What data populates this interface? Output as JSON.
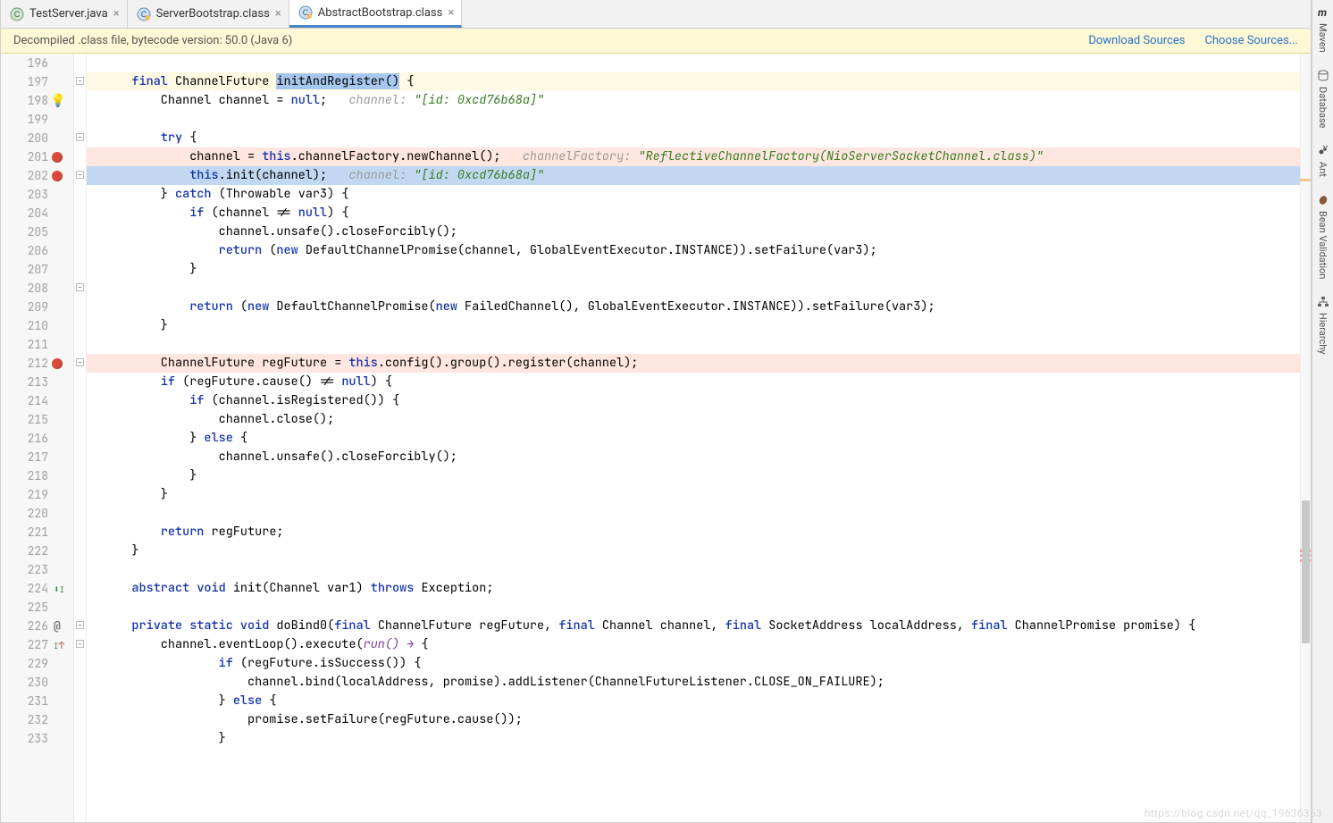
{
  "tabs": [
    {
      "label": "TestServer.java"
    },
    {
      "label": "ServerBootstrap.class"
    },
    {
      "label": "AbstractBootstrap.class"
    }
  ],
  "banner": {
    "text": "Decompiled .class file, bytecode version: 50.0 (Java 6)",
    "link1": "Download Sources",
    "link2": "Choose Sources..."
  },
  "side_tools": [
    {
      "label": "Maven"
    },
    {
      "label": "Database"
    },
    {
      "label": "Ant"
    },
    {
      "label": "Bean Validation"
    },
    {
      "label": "Hierarchy"
    }
  ],
  "gutter": {
    "lines": [
      "196",
      "197",
      "198",
      "199",
      "200",
      "201",
      "202",
      "203",
      "204",
      "205",
      "206",
      "207",
      "208",
      "209",
      "210",
      "211",
      "212",
      "213",
      "214",
      "215",
      "216",
      "217",
      "218",
      "219",
      "220",
      "221",
      "222",
      "223",
      "224",
      "225",
      "226",
      "227",
      "229",
      "230",
      "231",
      "232",
      "233"
    ],
    "icons": {
      "198": "bulb",
      "201": "breakpoint",
      "202": "breakpoint",
      "212": "breakpoint",
      "224": "impl-down",
      "226": "at",
      "227": "impl-up"
    }
  },
  "code": {
    "l196": "",
    "l197_kw": "final",
    "l197_type": "ChannelFuture",
    "l197_name": "initAndRegister()",
    "l197_tail": " {",
    "l198_a": "        Channel channel = ",
    "l198_null": "null",
    "l198_b": ";   ",
    "l198_c1": "channel: ",
    "l198_c2": "\"[id: 0xcd76b68a]\"",
    "l199": "",
    "l200_kw": "try",
    "l200_tail": " {",
    "l201_a": "            channel = ",
    "l201_this": "this",
    "l201_b": ".channelFactory.newChannel();   ",
    "l201_c1": "channelFactory: ",
    "l201_c2": "\"ReflectiveChannelFactory(NioServerSocketChannel.class)\"",
    "l202_a": "            ",
    "l202_this": "this",
    "l202_b": ".init(channel);   ",
    "l202_c1": "channel: ",
    "l202_c2": "\"[id: 0xcd76b68a]\"",
    "l203_a": "        } ",
    "l203_kw": "catch",
    "l203_b": " (Throwable var3) {",
    "l204_a": "            ",
    "l204_kw": "if",
    "l204_b": " (channel != ",
    "l204_null": "null",
    "l204_c": ") {",
    "l205": "                channel.unsafe().closeForcibly();",
    "l206_a": "                ",
    "l206_kw": "return",
    "l206_b": " (",
    "l206_new": "new",
    "l206_c": " DefaultChannelPromise(channel, GlobalEventExecutor.INSTANCE)).setFailure(var3);",
    "l207": "            }",
    "l208": "",
    "l209_a": "            ",
    "l209_kw": "return",
    "l209_b": " (",
    "l209_new": "new",
    "l209_c": " DefaultChannelPromise(",
    "l209_new2": "new",
    "l209_d": " FailedChannel(), GlobalEventExecutor.INSTANCE)).setFailure(var3);",
    "l210": "        }",
    "l211": "",
    "l212_a": "        ChannelFuture regFuture = ",
    "l212_this": "this",
    "l212_b": ".config().group().register(channel);",
    "l213_a": "        ",
    "l213_kw": "if",
    "l213_b": " (regFuture.cause() != ",
    "l213_null": "null",
    "l213_c": ") {",
    "l214_a": "            ",
    "l214_kw": "if",
    "l214_b": " (channel.isRegistered()) {",
    "l215": "                channel.close();",
    "l216_a": "            } ",
    "l216_kw": "else",
    "l216_b": " {",
    "l217": "                channel.unsafe().closeForcibly();",
    "l218": "            }",
    "l219": "        }",
    "l220": "",
    "l221_a": "        ",
    "l221_kw": "return",
    "l221_b": " regFuture;",
    "l222": "    }",
    "l223": "",
    "l224_a": "    ",
    "l224_kw1": "abstract",
    "l224_kw2": "void",
    "l224_b": " init(Channel var1) ",
    "l224_kw3": "throws",
    "l224_c": " Exception;",
    "l225": "",
    "l226_a": "    ",
    "l226_kw1": "private static void",
    "l226_b": " doBind0(",
    "l226_f1": "final",
    "l226_p1": " ChannelFuture regFuture, ",
    "l226_f2": "final",
    "l226_p2": " Channel channel, ",
    "l226_f3": "final",
    "l226_p3": " SocketAddress localAddress, ",
    "l226_f4": "final",
    "l226_p4": " ChannelPromise promise) {",
    "l227_a": "        channel.eventLoop().execute(",
    "l227_run": "run() ",
    "l227_arrow": "→",
    "l227_b": " {",
    "l229_a": "                ",
    "l229_kw": "if",
    "l229_b": " (regFuture.isSuccess()) {",
    "l230": "                    channel.bind(localAddress, promise).addListener(ChannelFutureListener.CLOSE_ON_FAILURE);",
    "l231_a": "                } ",
    "l231_kw": "else",
    "l231_b": " {",
    "l232": "                    promise.setFailure(regFuture.cause());",
    "l233": "                }"
  },
  "watermark": "https://blog.csdn.net/qq_19636353"
}
